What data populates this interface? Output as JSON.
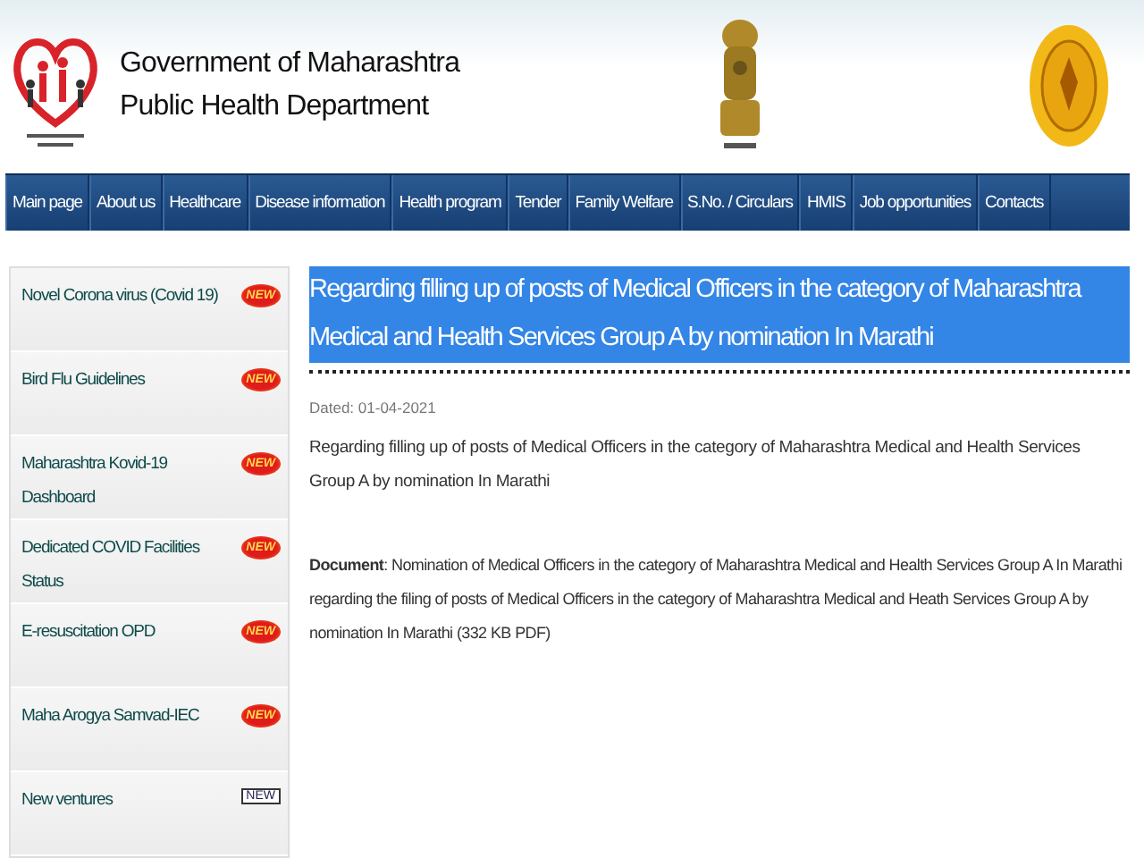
{
  "header": {
    "line_1": "Government of Maharashtra",
    "line_2": "Public Health Department"
  },
  "nav": [
    {
      "label": "Main page"
    },
    {
      "label": "About us"
    },
    {
      "label": "Healthcare"
    },
    {
      "label": "Disease information"
    },
    {
      "label": "Health program"
    },
    {
      "label": "Tender"
    },
    {
      "label": "Family Welfare"
    },
    {
      "label": "S.No. / Circulars"
    },
    {
      "label": "HMIS"
    },
    {
      "label": "Job opportunities"
    },
    {
      "label": "Contacts"
    }
  ],
  "sidebar": {
    "items": [
      {
        "label": "Novel Corona virus (Covid 19)",
        "badge": {
          "kind": "burst",
          "text": "NEW"
        }
      },
      {
        "label": "Bird Flu Guidelines",
        "badge": {
          "kind": "burst",
          "text": "NEW"
        }
      },
      {
        "label": "Maharashtra Kovid-19 Dashboard",
        "badge": {
          "kind": "burst",
          "text": "NEW"
        }
      },
      {
        "label": "Dedicated COVID Facilities Status",
        "badge": {
          "kind": "burst",
          "text": "NEW"
        }
      },
      {
        "label": "E-resuscitation OPD",
        "badge": {
          "kind": "burst",
          "text": "NEW"
        }
      },
      {
        "label": "Maha Arogya Samvad-IEC",
        "badge": {
          "kind": "burst",
          "text": "NEW"
        }
      },
      {
        "label": "New ventures",
        "badge": {
          "kind": "box",
          "text": "NEW"
        }
      }
    ]
  },
  "article": {
    "title": "Regarding filling up of posts of Medical Officers in the category of Maharashtra Medical and Health Services Group A by nomination In Marathi",
    "title_highlighted": true,
    "date": "Dated: 01-04-2021",
    "summary": "Regarding filling up of posts of Medical Officers in the category of Maharashtra Medical and Health Services Group A by nomination In Marathi",
    "document": "**Document**:  Nomination of Medical Officers in the category of Maharashtra Medical and Health Services Group A In Marathi regarding the filing of posts of Medical Officers in the category of Maharashtra Medical and Heath Services Group A by nomination In Marathi (332 KB PDF)"
  }
}
